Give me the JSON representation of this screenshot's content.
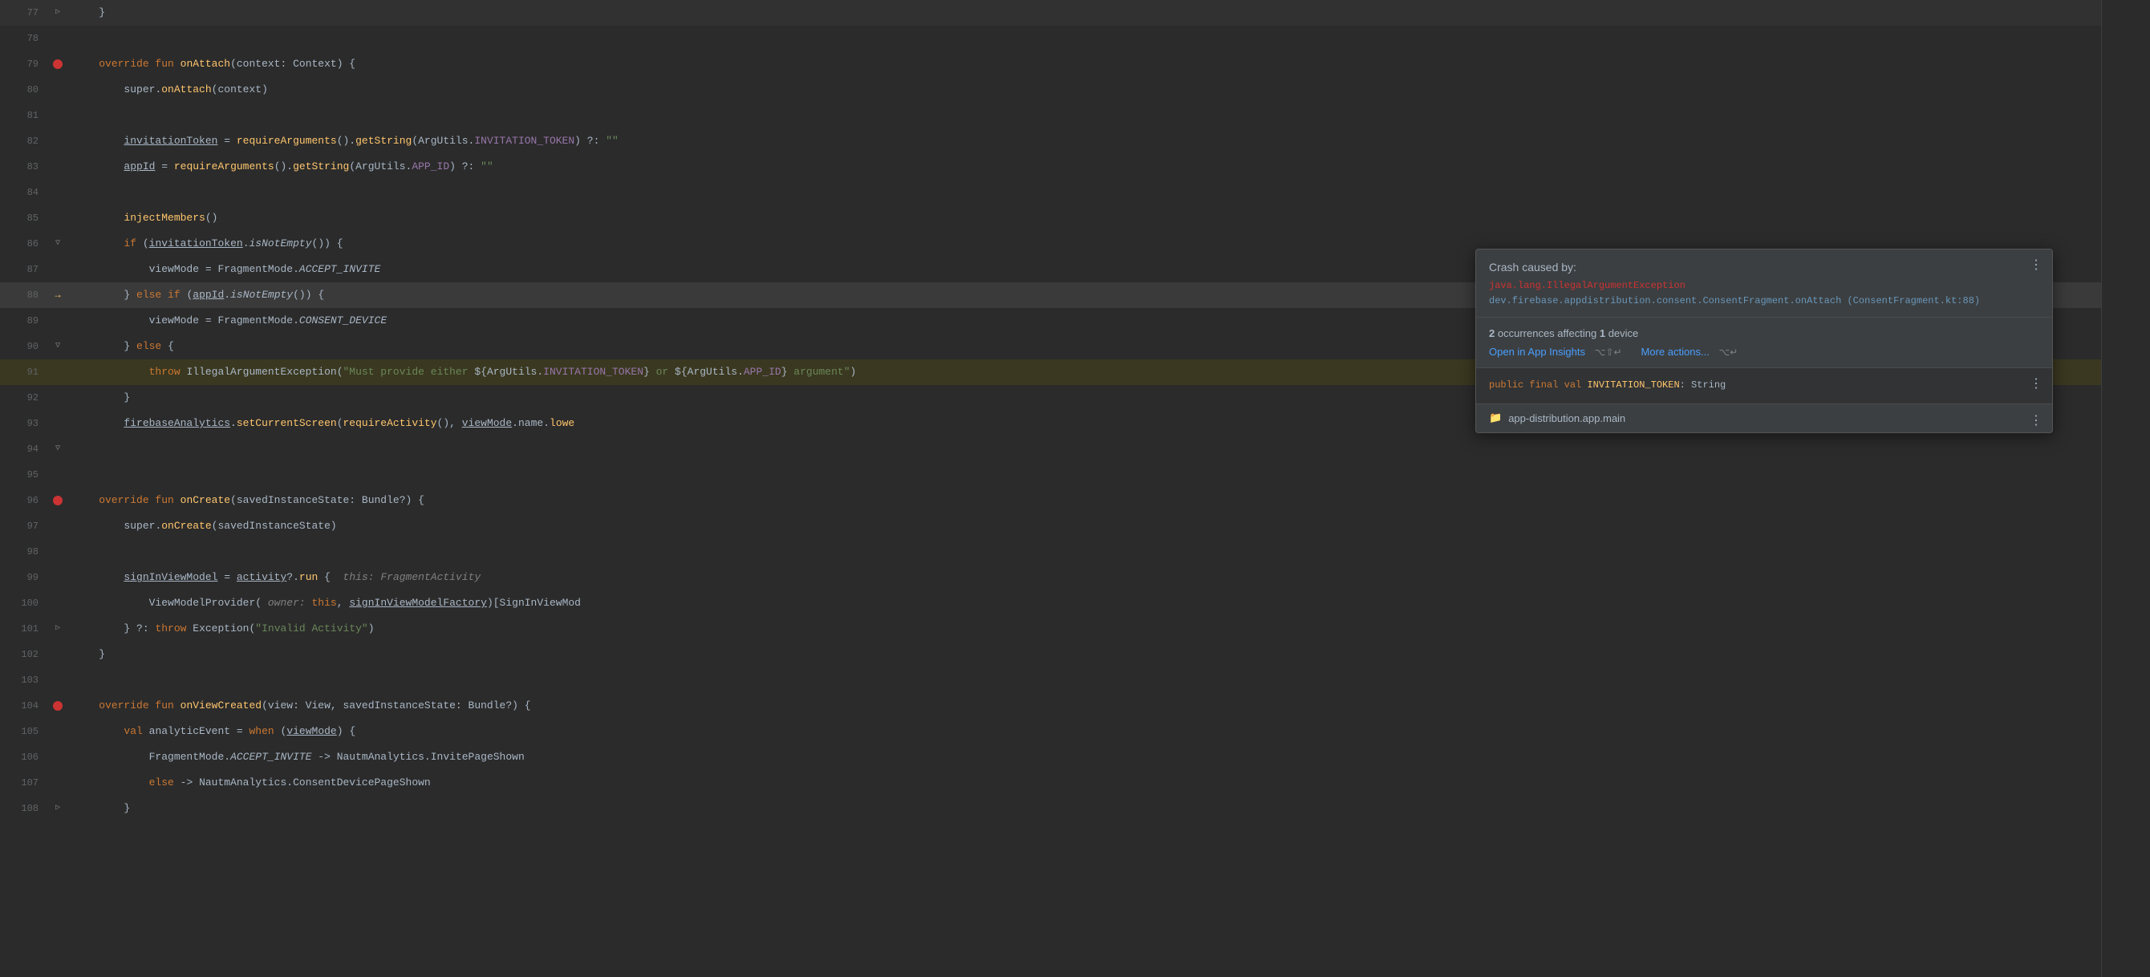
{
  "editor": {
    "lines": [
      {
        "num": 77,
        "gutter": "fold",
        "content": "    }"
      },
      {
        "num": 78,
        "gutter": "",
        "content": ""
      },
      {
        "num": 79,
        "gutter": "bp",
        "content": "    override fun onAttach(context: Context) {",
        "highlight": false
      },
      {
        "num": 80,
        "gutter": "",
        "content": "        super.onAttach(context)"
      },
      {
        "num": 81,
        "gutter": "",
        "content": ""
      },
      {
        "num": 82,
        "gutter": "",
        "content": "        invitationToken = requireArguments().getString(ArgUtils.INVITATION_TOKEN) ?: \"\"",
        "underline_words": [
          "invitationToken"
        ]
      },
      {
        "num": 83,
        "gutter": "",
        "content": "        appId = requireArguments().getString(ArgUtils.APP_ID) ?: \"\"",
        "underline_words": [
          "appId"
        ]
      },
      {
        "num": 84,
        "gutter": "",
        "content": ""
      },
      {
        "num": 85,
        "gutter": "",
        "content": "        injectMembers()"
      },
      {
        "num": 86,
        "gutter": "fold",
        "content": "        if (invitationToken.isNotEmpty()) {"
      },
      {
        "num": 87,
        "gutter": "",
        "content": "            viewMode = FragmentMode.ACCEPT_INVITE"
      },
      {
        "num": 88,
        "gutter": "arrow",
        "content": "        } else if (appId.isNotEmpty()) {",
        "highlight": true
      },
      {
        "num": 89,
        "gutter": "",
        "content": "            viewMode = FragmentMode.CONSENT_DEVICE"
      },
      {
        "num": 90,
        "gutter": "fold",
        "content": "        } else {"
      },
      {
        "num": 91,
        "gutter": "",
        "content": "            throw IllegalArgumentException(\"Must provide either ${ArgUtils.INVITATION_TOKEN} or ${ArgUtils.APP_ID} argument\")",
        "highlight_line": true
      },
      {
        "num": 92,
        "gutter": "",
        "content": "        }"
      },
      {
        "num": 93,
        "gutter": "",
        "content": "        firebaseAnalytics.setCurrentScreen(requireActivity(), viewMode.name.lowe"
      },
      {
        "num": 94,
        "gutter": "fold",
        "content": ""
      },
      {
        "num": 95,
        "gutter": "",
        "content": ""
      },
      {
        "num": 96,
        "gutter": "bp",
        "content": "    override fun onCreate(savedInstanceState: Bundle?) {"
      },
      {
        "num": 97,
        "gutter": "",
        "content": "        super.onCreate(savedInstanceState)"
      },
      {
        "num": 98,
        "gutter": "",
        "content": ""
      },
      {
        "num": 99,
        "gutter": "",
        "content": "        signInViewModel = activity?.run {  this: FragmentActivity"
      },
      {
        "num": 100,
        "gutter": "",
        "content": "            ViewModelProvider( owner: this, signInViewModelFactory)[SignInViewModel"
      },
      {
        "num": 101,
        "gutter": "fold",
        "content": "        } ?: throw Exception(\"Invalid Activity\")"
      },
      {
        "num": 102,
        "gutter": "",
        "content": "    }"
      },
      {
        "num": 103,
        "gutter": "",
        "content": ""
      },
      {
        "num": 104,
        "gutter": "bp",
        "content": "    override fun onViewCreated(view: View, savedInstanceState: Bundle?) {"
      },
      {
        "num": 105,
        "gutter": "",
        "content": "        val analyticEvent = when (viewMode) {"
      },
      {
        "num": 106,
        "gutter": "",
        "content": "            FragmentMode.ACCEPT_INVITE -> NautmAnalytics.InvitePageShown"
      },
      {
        "num": 107,
        "gutter": "",
        "content": "            else -> NautmAnalytics.ConsentDevicePageShown"
      },
      {
        "num": 108,
        "gutter": "fold",
        "content": "        }"
      }
    ]
  },
  "popup": {
    "title": "Crash caused by:",
    "exception_main": "java.lang.IllegalArgumentException",
    "exception_trace": "dev.firebase.appdistribution.consent.ConsentFragment.onAttach (ConsentFragment.kt:88)",
    "occurrences_count": "2",
    "occurrences_label": "occurrences",
    "affecting": "affecting",
    "device_count": "1",
    "device_label": "device",
    "action_open": "Open in App Insights",
    "action_open_shortcut": "⌥⇧↵",
    "action_more": "More actions...",
    "action_more_shortcut": "⌥↵",
    "code_preview": "public final val INVITATION_TOKEN: String",
    "module_icon": "📁",
    "module_name": "app-distribution.app.main",
    "more_dots_top": "⋮",
    "more_dots_bottom": "⋮"
  },
  "colors": {
    "bg": "#2b2b2b",
    "popup_bg": "#3c3f41",
    "line_highlight": "#3a3a3a",
    "throw_highlight": "#3a3320",
    "keyword": "#cc7832",
    "function": "#ffc66d",
    "string": "#6a8759",
    "number": "#6897bb",
    "const": "#9876aa",
    "error_red": "#cc3333",
    "link_blue": "#4a9eff",
    "line_num": "#606366",
    "default_text": "#a9b7c6"
  }
}
